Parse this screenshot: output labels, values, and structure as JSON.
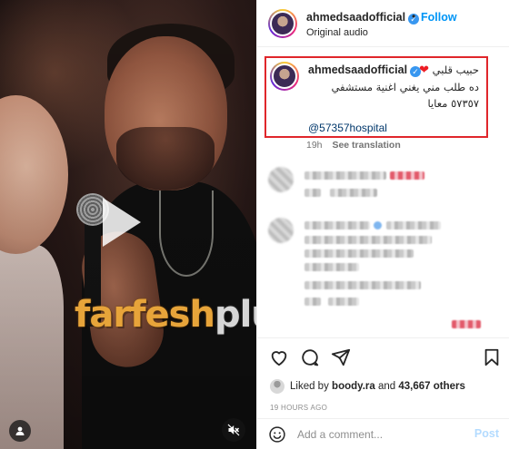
{
  "video": {
    "watermark_part1": "farfesh",
    "watermark_part2": "plus.com",
    "play_icon": "play-icon",
    "user_icon": "user-tag-icon",
    "mute_icon": "speaker-muted-icon"
  },
  "header": {
    "username": "ahmedsaadofficial",
    "verified_mark": "✓",
    "separator": "•",
    "follow_label": "Follow",
    "audio_label": "Original audio"
  },
  "caption": {
    "username": "ahmedsaadofficial",
    "verified_mark": "✓",
    "line1_text": "حبيب قلبي",
    "line1_emoji": "❤",
    "line2": "ده طلب مني يغني اغنية مستشفي",
    "line3": "٥٧٣٥٧ معايا",
    "mention": "@57357hospital"
  },
  "caption_meta": {
    "time": "19h",
    "see_translation": "See translation"
  },
  "actions": {
    "like_icon": "heart-icon",
    "comment_icon": "comment-icon",
    "share_icon": "send-icon",
    "save_icon": "bookmark-icon"
  },
  "likes": {
    "prefix": "Liked by",
    "user": "boody.ra",
    "and": "and",
    "count": "43,667 others"
  },
  "time_ago": "19 HOURS AGO",
  "comment_box": {
    "placeholder": "Add a comment...",
    "post_label": "Post",
    "emoji_icon": "emoji-smile-icon"
  },
  "colors": {
    "follow_blue": "#0095f6",
    "highlight_red": "#e0262b",
    "mention_blue": "#00376b",
    "post_disabled": "#b3dbff"
  }
}
